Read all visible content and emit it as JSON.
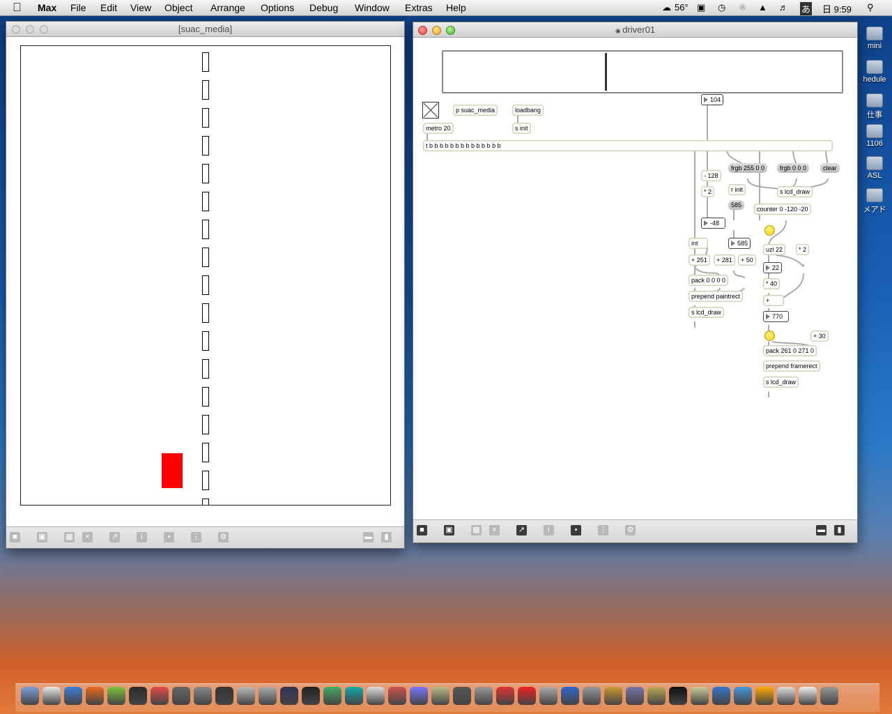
{
  "menubar": {
    "app": "Max",
    "items": [
      "File",
      "Edit",
      "View",
      "Object",
      "Arrange",
      "Options",
      "Debug",
      "Window",
      "Extras",
      "Help"
    ],
    "temp": "56°",
    "ime": "あ",
    "clock": "日 9:59"
  },
  "desktop_icons": [
    "mini",
    "hedule",
    "仕事",
    "1106",
    "ASL",
    "メアド"
  ],
  "left_window": {
    "title": "[suac_media]",
    "red_rect_color": "#ff0000"
  },
  "right_window": {
    "title": "driver01",
    "slider_value": 104,
    "objects": {
      "p_suac_media": "p suac_media",
      "loadbang": "loadbang",
      "metro": "metro 20",
      "s_init": "s init",
      "trigger": "t b b b b b b b b b b b b b b",
      "minus128": "- 128",
      "times2a": "* 2",
      "num_minus48": "-48",
      "r_init": "r init",
      "num_585a": "585",
      "num_585b": "585",
      "int": "int",
      "plus251": "+ 251",
      "plus281": "+ 281",
      "plus50": "+ 50",
      "pack0000": "pack 0 0 0 0",
      "prepend_paintrect": "prepend paintrect",
      "s_lcd_draw_a": "s lcd_draw",
      "frgb_red": "frgb 255 0 0",
      "frgb_black": "frgb 0 0 0",
      "clear": "clear",
      "s_lcd_draw_b": "s lcd_draw",
      "counter": "counter 0 -120 -20",
      "uzi": "uzi 22",
      "times2b": "* 2",
      "num_22": "22",
      "times40": "* 40",
      "plus": "+",
      "num_770": "770",
      "plus30": "+ 30",
      "pack261": "pack 261 0 271 0",
      "prepend_framerect": "prepend framerect",
      "s_lcd_draw_c": "s lcd_draw"
    }
  }
}
